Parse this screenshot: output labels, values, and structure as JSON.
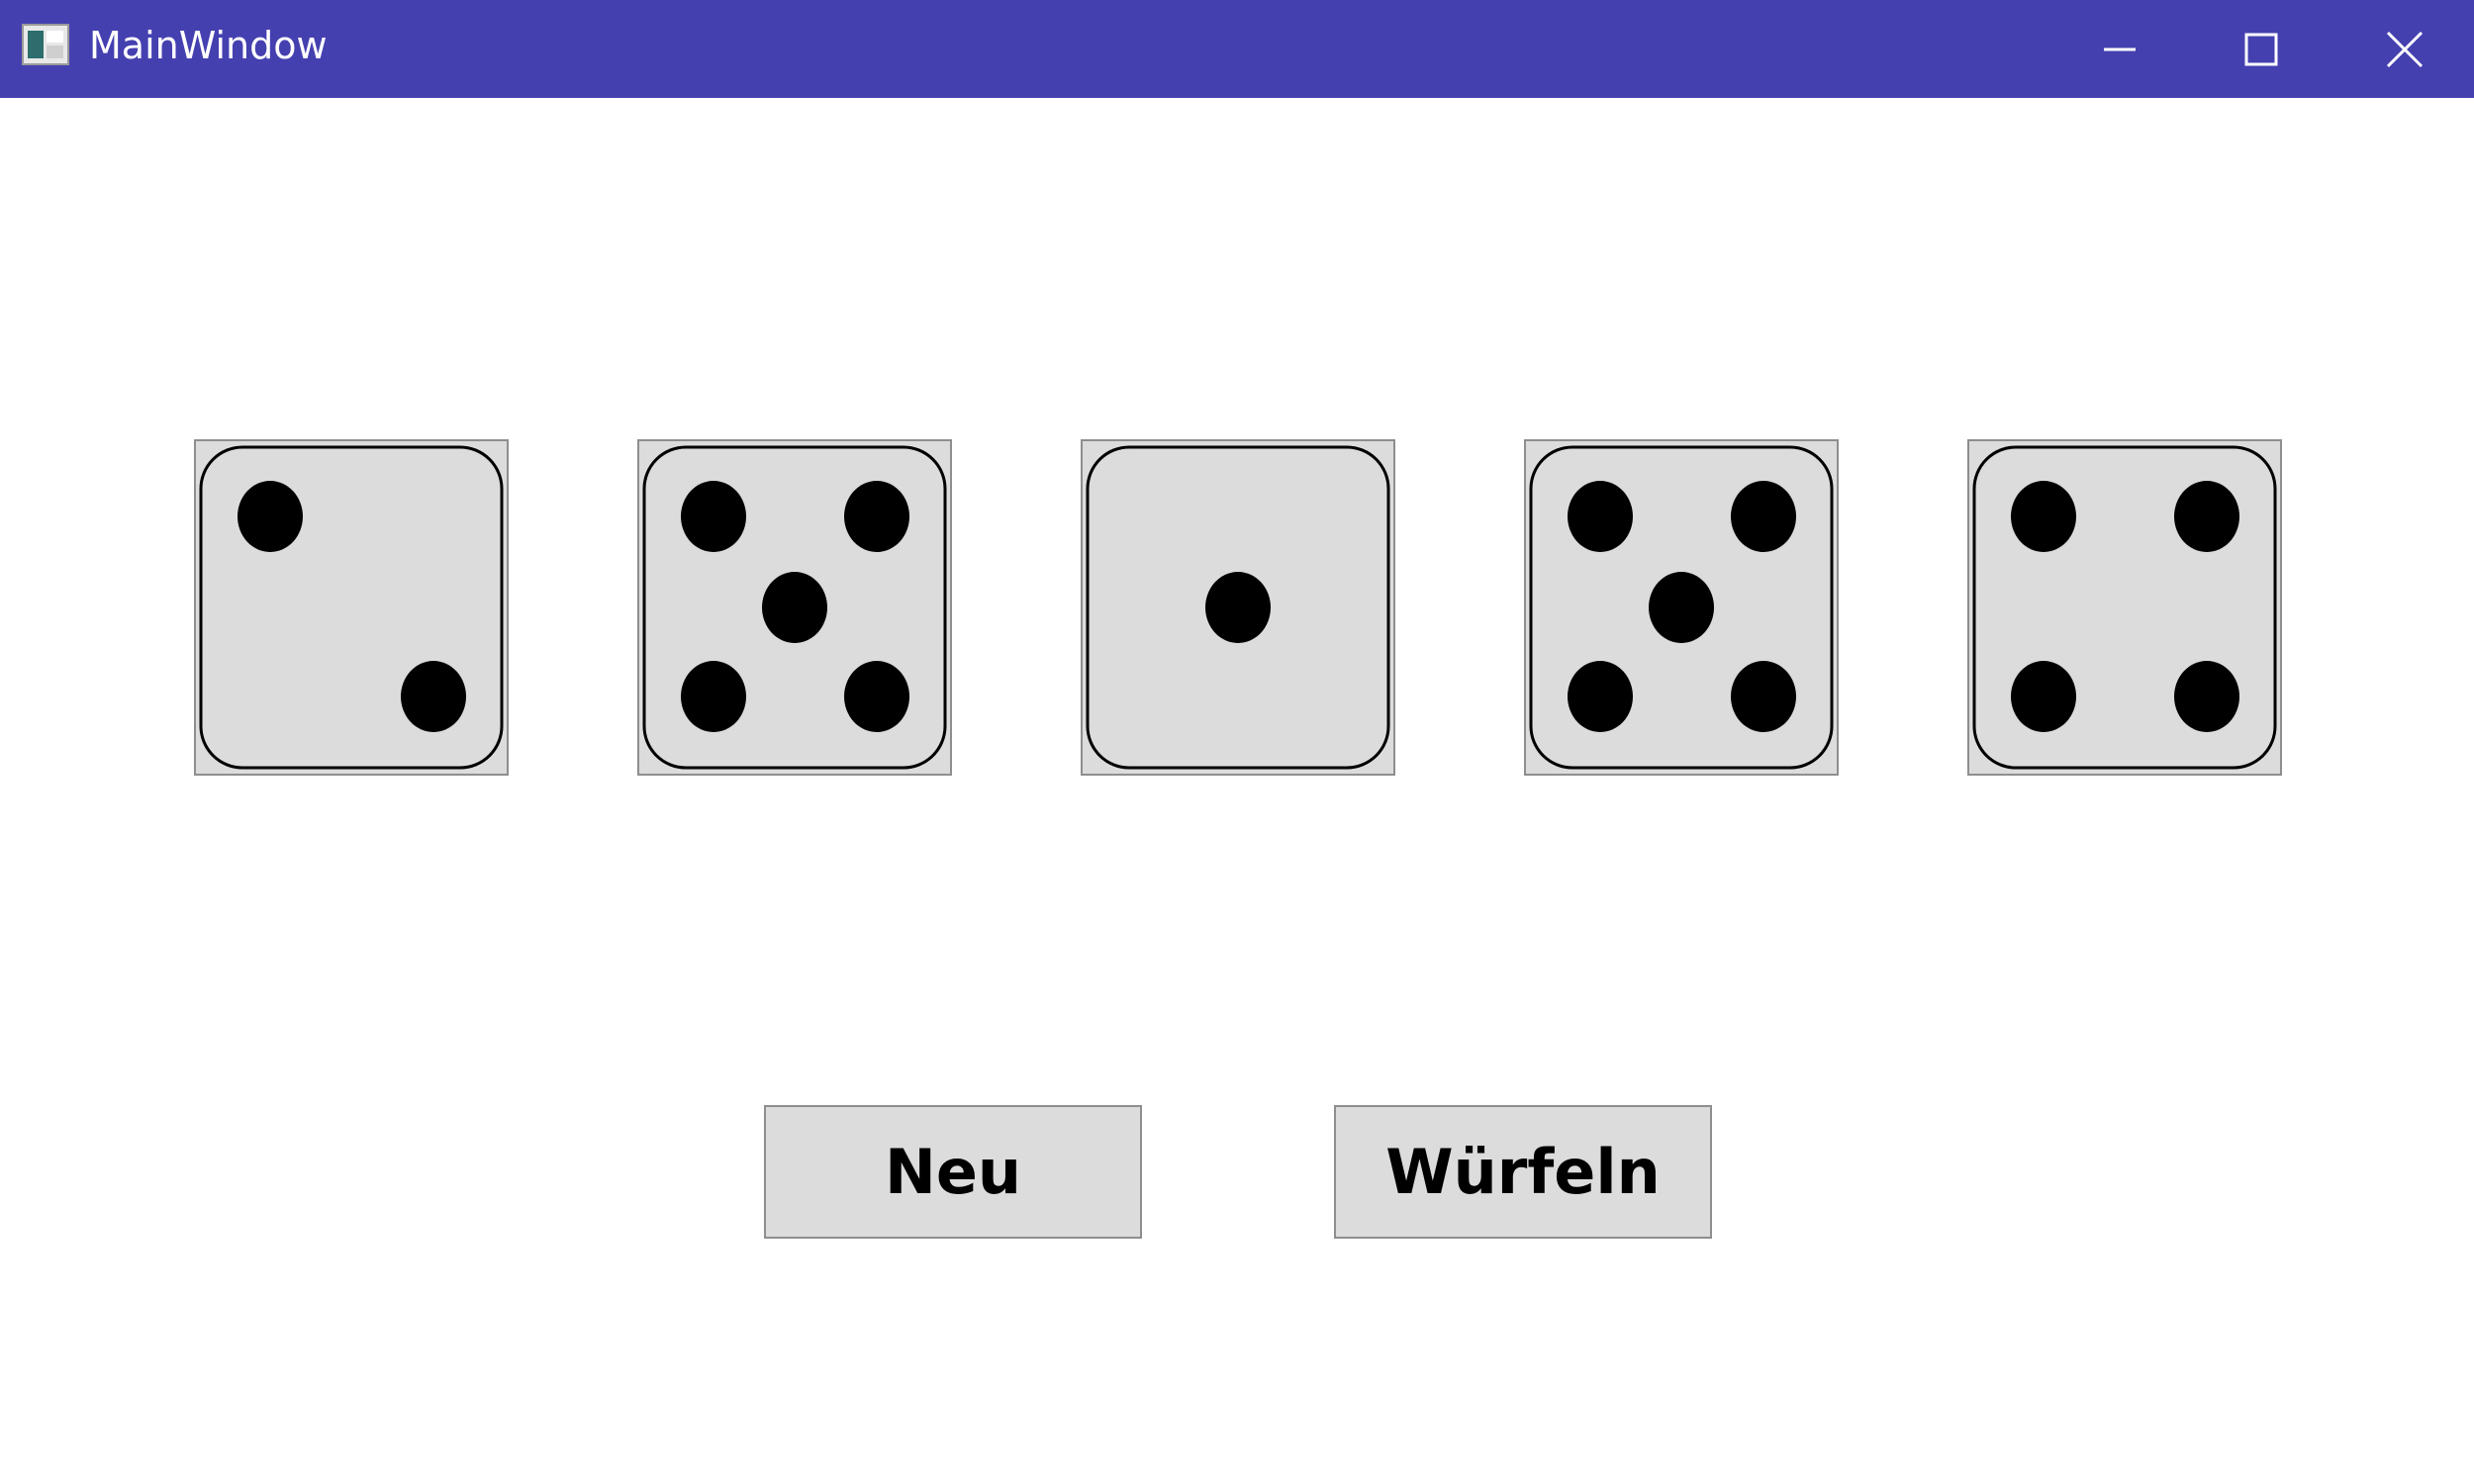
{
  "window": {
    "title": "MainWindow",
    "titlebar_color": "#4540b0",
    "controls": {
      "minimize_icon": "minimize-icon",
      "maximize_icon": "maximize-icon",
      "close_icon": "close-icon"
    }
  },
  "dice": [
    {
      "value": 2
    },
    {
      "value": 5
    },
    {
      "value": 1
    },
    {
      "value": 5
    },
    {
      "value": 4
    }
  ],
  "buttons": {
    "new_label": "Neu",
    "roll_label": "Würfeln"
  },
  "colors": {
    "die_face": "#dcdcdc",
    "pip": "#000000"
  }
}
